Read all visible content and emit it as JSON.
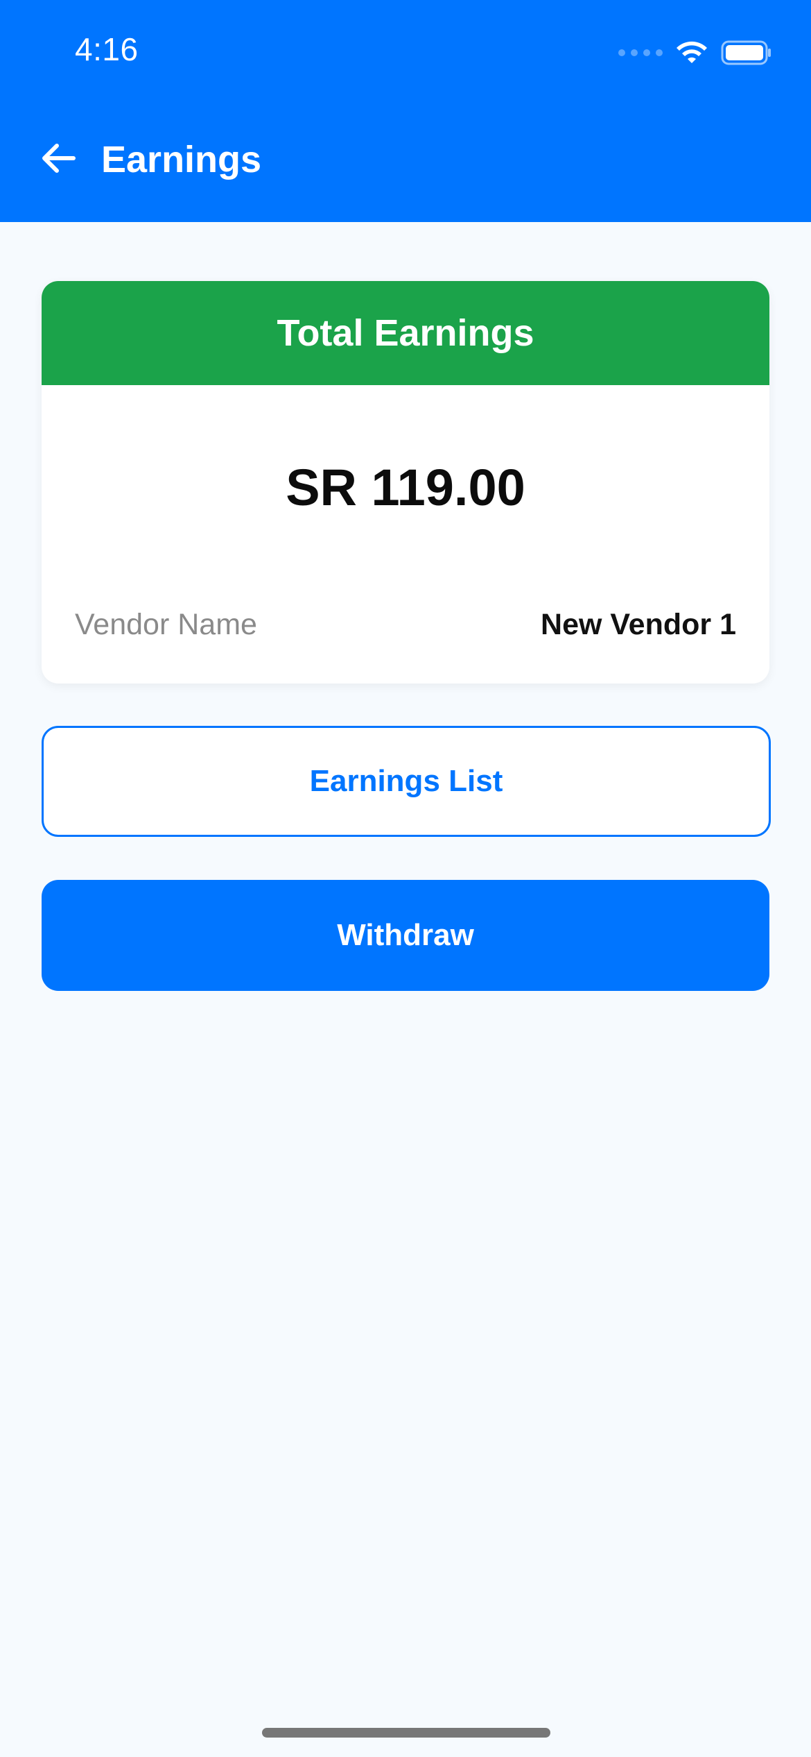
{
  "status_bar": {
    "time": "4:16"
  },
  "header": {
    "title": "Earnings",
    "back_icon": "arrow-left-icon"
  },
  "earnings_card": {
    "title": "Total Earnings",
    "amount": "SR 119.00",
    "vendor_label": "Vendor Name",
    "vendor_value": "New Vendor 1"
  },
  "actions": {
    "earnings_list_label": "Earnings List",
    "withdraw_label": "Withdraw"
  },
  "colors": {
    "primary": "#0075FF",
    "success": "#1BA34A",
    "background": "#F6FAFE"
  }
}
